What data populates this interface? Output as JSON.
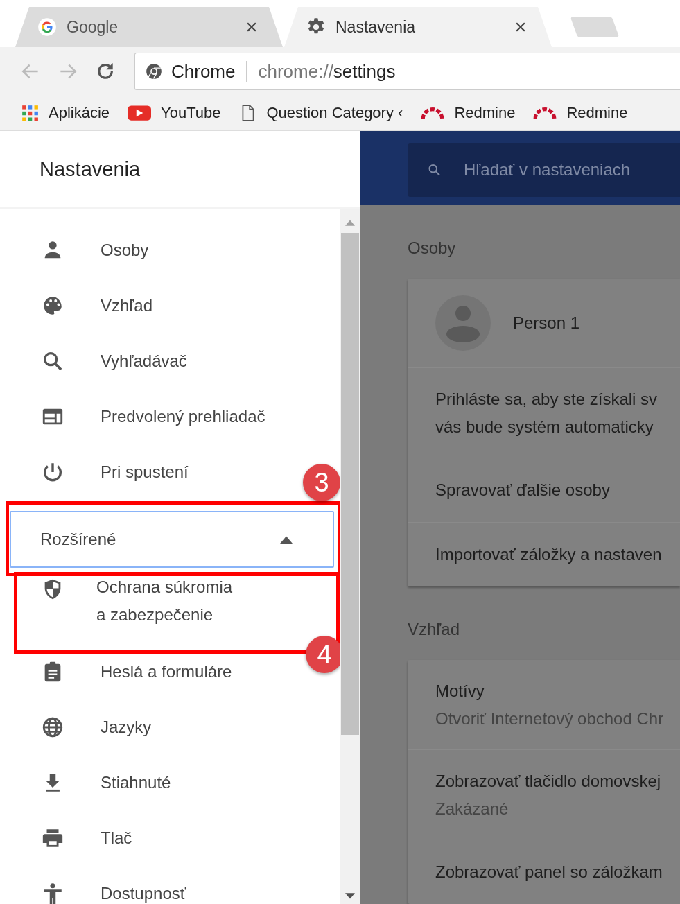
{
  "tabs": [
    {
      "title": "Google",
      "selected": false
    },
    {
      "title": "Nastavenia",
      "selected": true
    }
  ],
  "omnibox": {
    "chip": "Chrome",
    "scheme": "chrome://",
    "path": "settings"
  },
  "bookmarks": [
    "Aplikácie",
    "YouTube",
    "Question Category ‹",
    "Redmine",
    "Redmine"
  ],
  "sidebar": {
    "title": "Nastavenia",
    "items": [
      {
        "label": "Osoby"
      },
      {
        "label": "Vzhľad"
      },
      {
        "label": "Vyhľadávač"
      },
      {
        "label": "Predvolený prehliadač"
      },
      {
        "label": "Pri spustení"
      }
    ],
    "advanced": {
      "label": "Rozšírené",
      "expanded": true,
      "callout": "3"
    },
    "advanced_items": [
      {
        "label": "Ochrana súkromia a zabezpečenie",
        "callout": "4"
      },
      {
        "label": "Heslá a formuláre"
      },
      {
        "label": "Jazyky"
      },
      {
        "label": "Stiahnuté"
      },
      {
        "label": "Tlač"
      },
      {
        "label": "Dostupnosť"
      }
    ]
  },
  "search": {
    "placeholder": "Hľadať v nastaveniach"
  },
  "sections": [
    {
      "title": "Osoby",
      "rows": [
        {
          "kind": "profile",
          "text": "Person 1"
        },
        {
          "kind": "text",
          "lines": [
            "Prihláste sa, aby ste získali sv",
            "vás bude systém automaticky"
          ]
        },
        {
          "kind": "text",
          "lines": [
            "Spravovať ďalšie osoby"
          ]
        },
        {
          "kind": "text",
          "lines": [
            "Importovať záložky a nastaven"
          ]
        }
      ]
    },
    {
      "title": "Vzhľad",
      "rows": [
        {
          "kind": "setting",
          "text": "Motívy",
          "sub": "Otvoriť Internetový obchod Chr"
        },
        {
          "kind": "setting",
          "text": "Zobrazovať tlačidlo domovskej",
          "sub": "Zakázané"
        },
        {
          "kind": "text",
          "lines": [
            "Zobrazovať panel so záložkam"
          ]
        }
      ]
    }
  ]
}
